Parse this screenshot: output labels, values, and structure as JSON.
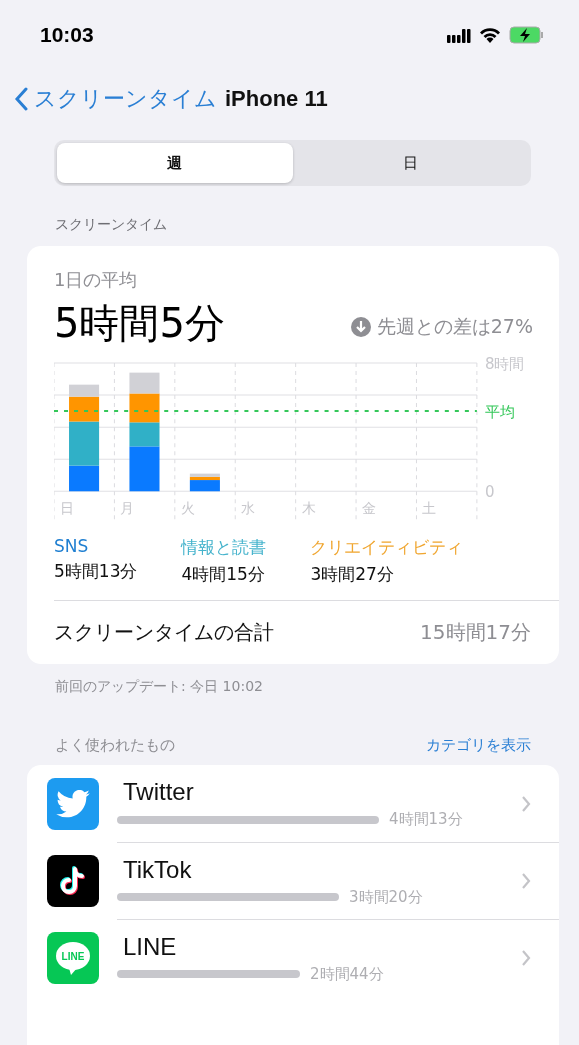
{
  "status_bar": {
    "time": "10:03"
  },
  "nav": {
    "back_label": "スクリーンタイム",
    "title": "iPhone 11"
  },
  "segments": [
    {
      "label": "週",
      "selected": true
    },
    {
      "label": "日",
      "selected": false
    }
  ],
  "section_title": "スクリーンタイム",
  "summary": {
    "caption": "1日の平均",
    "value": "5時間5分",
    "comparison": "先週との差は27%",
    "chart_data": {
      "type": "bar",
      "stacked": true,
      "categories": [
        "日",
        "月",
        "火",
        "水",
        "木",
        "金",
        "土"
      ],
      "series": [
        {
          "name": "SNS",
          "color": "#0a7aff",
          "values": [
            1.6,
            2.8,
            0.7,
            null,
            null,
            null,
            null
          ]
        },
        {
          "name": "情報と読書",
          "color": "#30b0c7",
          "values": [
            2.75,
            1.5,
            0,
            null,
            null,
            null,
            null
          ]
        },
        {
          "name": "クリエイティビティ",
          "color": "#ff9500",
          "values": [
            1.55,
            1.8,
            0.2,
            null,
            null,
            null,
            null
          ]
        },
        {
          "color": "#d1d1d6",
          "values": [
            0.75,
            1.3,
            0.2,
            null,
            null,
            null,
            null
          ]
        }
      ],
      "ylim": [
        0,
        8
      ],
      "yticks": [
        {
          "value": 0,
          "label": "0"
        },
        {
          "value": 8,
          "label": "8時間"
        }
      ],
      "ref_lines": [
        {
          "axis": "y",
          "value": 5,
          "label": "平均"
        }
      ]
    },
    "legend": [
      {
        "time": "5時間13分",
        "color": "#1f7fd1"
      },
      {
        "time": "4時間15分",
        "color": "#45b3cc"
      },
      {
        "time": "3時間27分",
        "color": "#f0a630"
      }
    ],
    "total_label": "スクリーンタイムの合計",
    "total_value": "15時間17分"
  },
  "updated": "前回のアップデート: 今日 10:02",
  "most_used": {
    "title": "よく使われたもの",
    "action": "カテゴリを表示",
    "apps": [
      {
        "kind": "twitter",
        "name": "Twitter",
        "time": "4時間13分"
      },
      {
        "kind": "tiktok",
        "name": "TikTok",
        "time": "3時間20分"
      },
      {
        "kind": "line",
        "name": "LINE",
        "icon_label": "LINE",
        "time": "2時間44分"
      }
    ]
  }
}
